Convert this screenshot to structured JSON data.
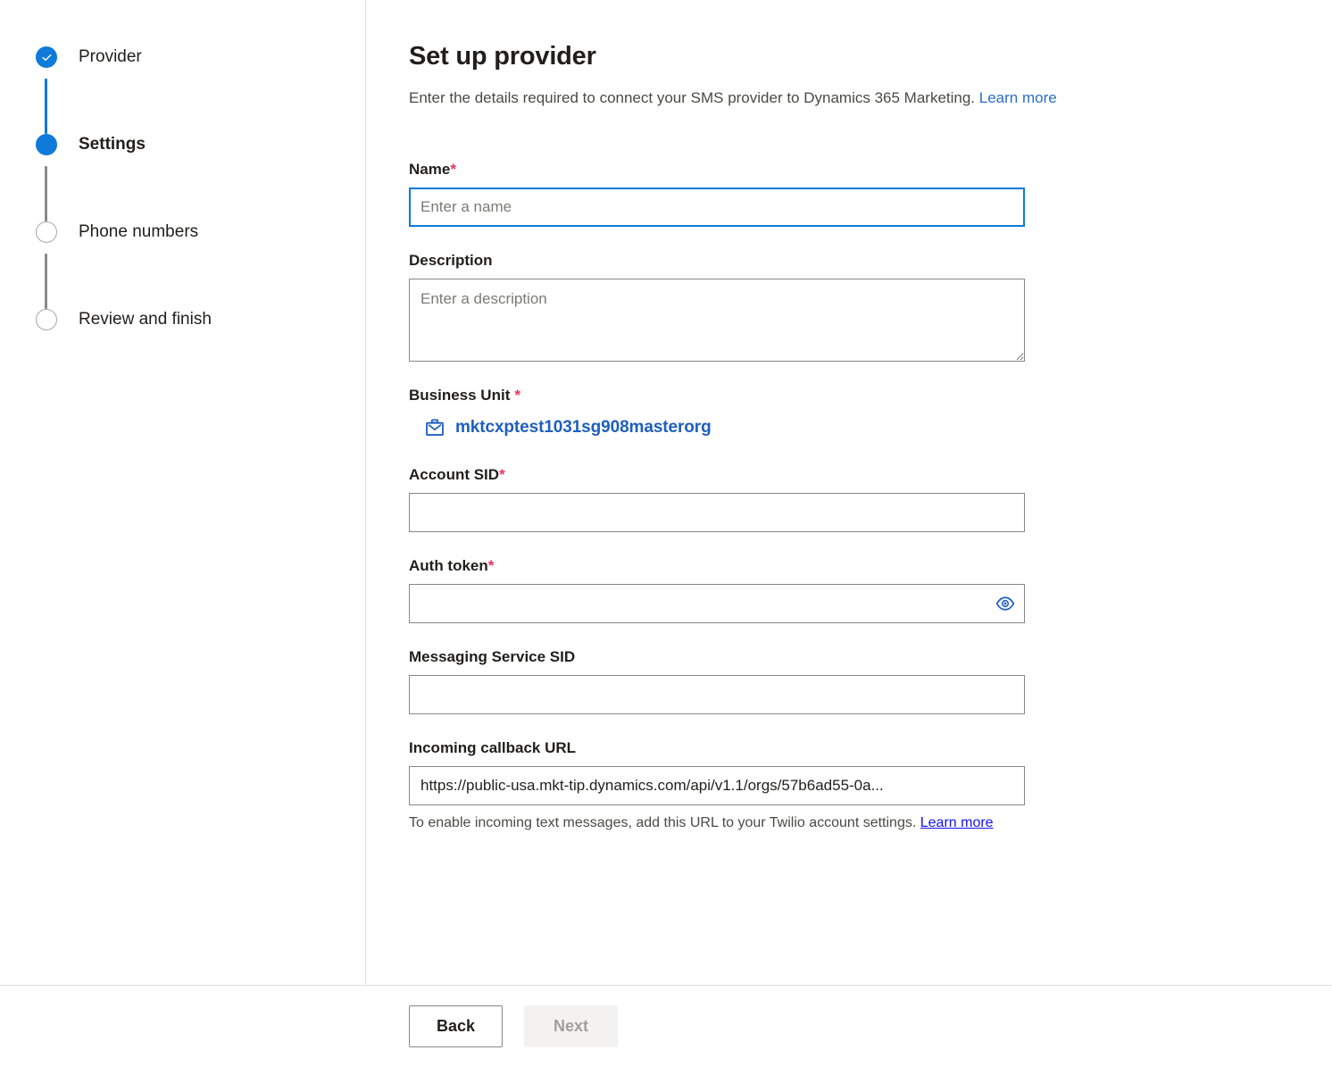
{
  "wizard": {
    "steps": [
      {
        "label": "Provider",
        "state": "done",
        "icon": "check-icon"
      },
      {
        "label": "Settings",
        "state": "current",
        "icon": "filled-circle-icon"
      },
      {
        "label": "Phone numbers",
        "state": "pending",
        "icon": "empty-circle-icon"
      },
      {
        "label": "Review and finish",
        "state": "pending",
        "icon": "empty-circle-icon"
      }
    ]
  },
  "header": {
    "title": "Set up provider",
    "subtitle": "Enter the details required to connect your SMS provider to Dynamics 365 Marketing.",
    "learn_more": "Learn more"
  },
  "form": {
    "name": {
      "label": "Name",
      "required_marker": "*",
      "value": "",
      "placeholder": "Enter a name",
      "focused": true
    },
    "description": {
      "label": "Description",
      "value": "",
      "placeholder": "Enter a description"
    },
    "business_unit": {
      "label": "Business Unit",
      "required_marker": "*",
      "icon": "briefcase-icon",
      "value": "mktcxptest1031sg908masterorg"
    },
    "account_sid": {
      "label": "Account SID",
      "required_marker": "*",
      "value": "",
      "placeholder": ""
    },
    "auth_token": {
      "label": "Auth token",
      "required_marker": "*",
      "value": "",
      "placeholder": "",
      "reveal_icon": "eye-icon"
    },
    "messaging_service_sid": {
      "label": "Messaging Service SID",
      "value": "",
      "placeholder": ""
    },
    "incoming_callback_url": {
      "label": "Incoming callback URL",
      "value": "https://public-usa.mkt-tip.dynamics.com/api/v1.1/orgs/57b6ad55-0a...",
      "hint_text": "To enable incoming text messages, add this URL to your Twilio account settings.",
      "hint_link": "Learn more"
    }
  },
  "footer": {
    "back_label": "Back",
    "next_label": "Next"
  },
  "colors": {
    "accent": "#0f7ad9",
    "required": "#e8335a",
    "link": "#2a6dc9",
    "link_underlined": "#1414ee",
    "lookup": "#1f5fbf",
    "divider": "#e1dfdd",
    "disabled_bg": "#f3f2f1",
    "disabled_text": "#a19f9d"
  }
}
